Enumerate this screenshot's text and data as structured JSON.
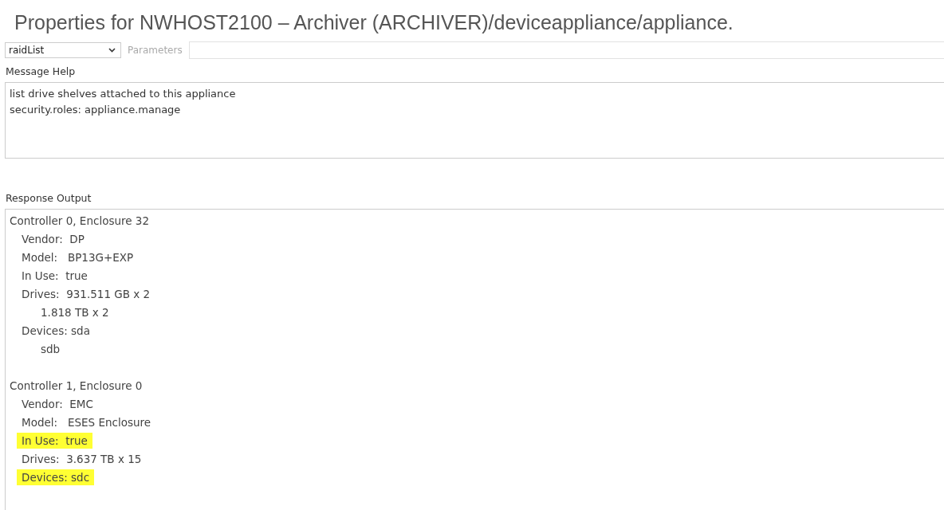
{
  "window": {
    "title": "Properties for NWHOST2100 – Archiver (ARCHIVER)/deviceappliance/appliance."
  },
  "toolbar": {
    "message_select": "raidList",
    "parameters": {
      "placeholder": "Parameters"
    }
  },
  "message_help": {
    "label": "Message Help",
    "lines": [
      "list drive shelves attached to this appliance",
      "security.roles: appliance.manage"
    ]
  },
  "response_output": {
    "label": "Response Output",
    "sections": [
      {
        "text": "Controller 0, Enclosure 32",
        "highlighted": false,
        "children": [
          {
            "text": "Vendor:  DP",
            "highlighted": false
          },
          {
            "text": "Model:   BP13G+EXP",
            "highlighted": false
          },
          {
            "text": "In Use:  true",
            "highlighted": false
          },
          {
            "text": "Drives:  931.511 GB x 2",
            "highlighted": false,
            "children": [
              {
                "text": "1.818 TB x 2",
                "highlighted": false
              }
            ]
          },
          {
            "text": "Devices: sda",
            "highlighted": false,
            "children": [
              {
                "text": "sdb",
                "highlighted": false
              }
            ]
          }
        ]
      },
      {
        "text": "Controller 1, Enclosure 0",
        "highlighted": false,
        "children": [
          {
            "text": "Vendor:  EMC",
            "highlighted": false
          },
          {
            "text": "Model:   ESES Enclosure",
            "highlighted": false
          },
          {
            "text": "In Use:  true",
            "highlighted": true
          },
          {
            "text": "Drives:  3.637 TB x 15",
            "highlighted": false
          },
          {
            "text": "Devices: sdc",
            "highlighted": true
          }
        ]
      }
    ]
  }
}
